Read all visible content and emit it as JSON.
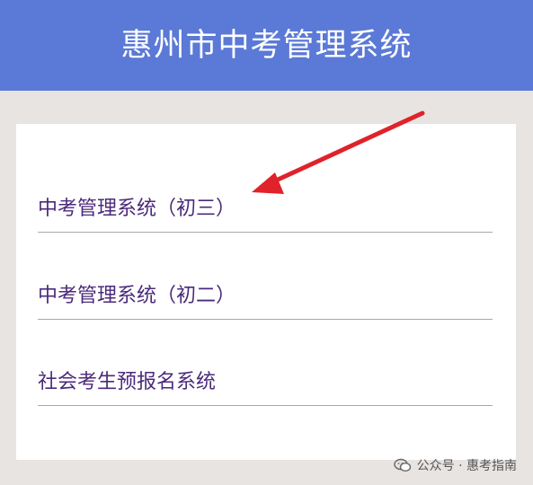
{
  "header": {
    "title": "惠州市中考管理系统",
    "background": "#5b79d6"
  },
  "menu": {
    "items": [
      {
        "label": "中考管理系统（初三）"
      },
      {
        "label": "中考管理系统（初二）"
      },
      {
        "label": "社会考生预报名系统"
      }
    ],
    "text_color": "#4b2a7b"
  },
  "annotation": {
    "arrow_color": "#e0222a"
  },
  "watermark": {
    "text": "公众号 · 惠考指南",
    "icon": "wechat-icon"
  }
}
